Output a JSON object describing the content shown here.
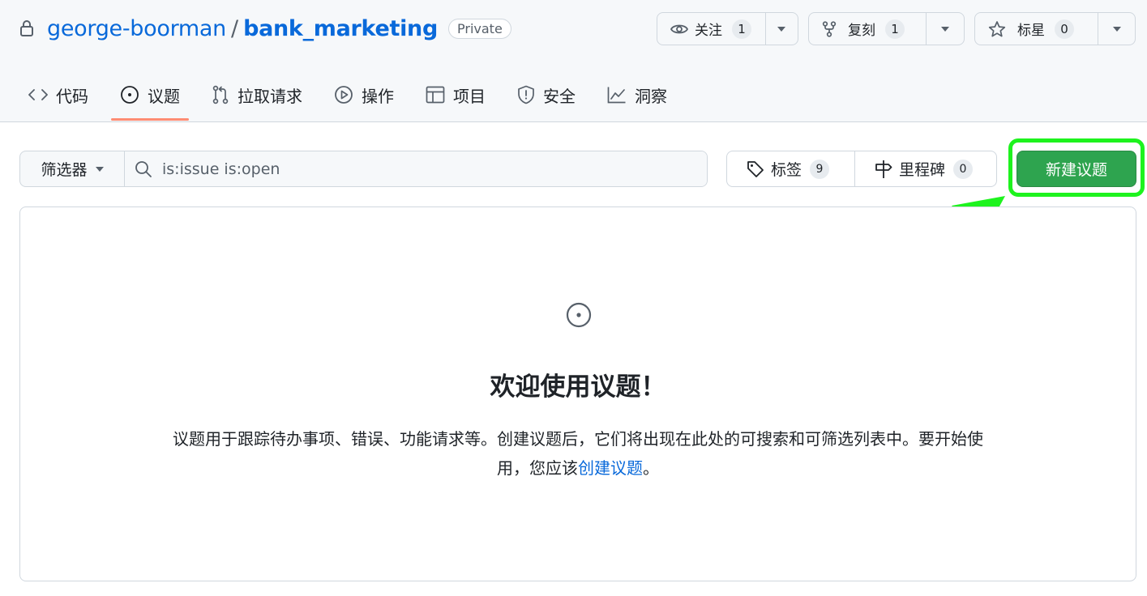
{
  "repo": {
    "owner": "george-boorman",
    "separator": "/",
    "name": "bank_marketing",
    "visibility": "Private"
  },
  "actions": {
    "watch": {
      "label": "关注",
      "count": "1"
    },
    "fork": {
      "label": "复刻",
      "count": "1"
    },
    "star": {
      "label": "标星",
      "count": "0"
    }
  },
  "tabs": [
    {
      "label": "代码",
      "icon": "code-icon"
    },
    {
      "label": "议题",
      "icon": "issue-opened-icon",
      "active": true
    },
    {
      "label": "拉取请求",
      "icon": "pull-request-icon"
    },
    {
      "label": "操作",
      "icon": "play-icon"
    },
    {
      "label": "项目",
      "icon": "table-icon"
    },
    {
      "label": "安全",
      "icon": "shield-icon"
    },
    {
      "label": "洞察",
      "icon": "graph-icon"
    }
  ],
  "toolbar": {
    "filter_label": "筛选器",
    "search_value": "is:issue is:open",
    "labels": {
      "label": "标签",
      "count": "9"
    },
    "milestones": {
      "label": "里程碑",
      "count": "0"
    },
    "new_issue_label": "新建议题"
  },
  "blankslate": {
    "title": "欢迎使用议题！",
    "description_part1": "议题用于跟踪待办事项、错误、功能请求等。创建议题后，它们将出现在此处的可搜索和可筛选列表中。要开始使用，您应该",
    "link_text": "创建议题",
    "description_end": "。"
  },
  "colors": {
    "link": "#0969da",
    "primary_button": "#2ea44f",
    "highlight": "#1ef31e",
    "active_tab_underline": "#fd8c73"
  }
}
